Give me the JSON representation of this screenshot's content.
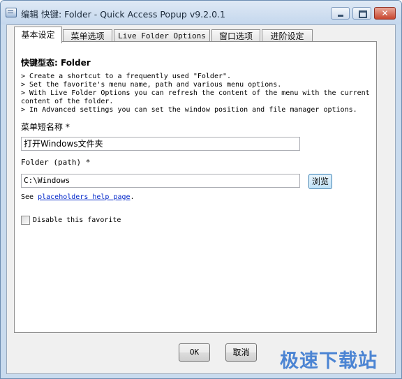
{
  "window": {
    "title": "编辑 快键: Folder - Quick Access Popup v9.2.0.1",
    "controls": {
      "close": "✕"
    }
  },
  "tabs": [
    {
      "label": "基本设定",
      "active": true
    },
    {
      "label": "菜单选项",
      "active": false
    },
    {
      "label": "Live Folder Options",
      "active": false
    },
    {
      "label": "窗口选项",
      "active": false
    },
    {
      "label": "进阶设定",
      "active": false
    }
  ],
  "panel": {
    "heading": "快键型态: Folder",
    "description": [
      "> Create a shortcut to a frequently used \"Folder\".",
      "> Set the favorite's menu name, path and various menu options.",
      "> With Live Folder Options you can refresh the content of the menu with the current content of the folder.",
      "> In Advanced settings you can set the window position and file manager options."
    ],
    "menu_name_label": "菜单短名称 *",
    "menu_name_value": "打开Windows文件夹",
    "folder_label": "Folder (path) *",
    "folder_value": "C:\\Windows",
    "browse_label": "浏览",
    "help_prefix": "See ",
    "help_link": "placeholders help page",
    "help_suffix": ".",
    "disable_label": "Disable this favorite",
    "disable_checked": false
  },
  "footer": {
    "ok_label": "OK",
    "cancel_label": "取消"
  },
  "watermark": "极速下载站"
}
